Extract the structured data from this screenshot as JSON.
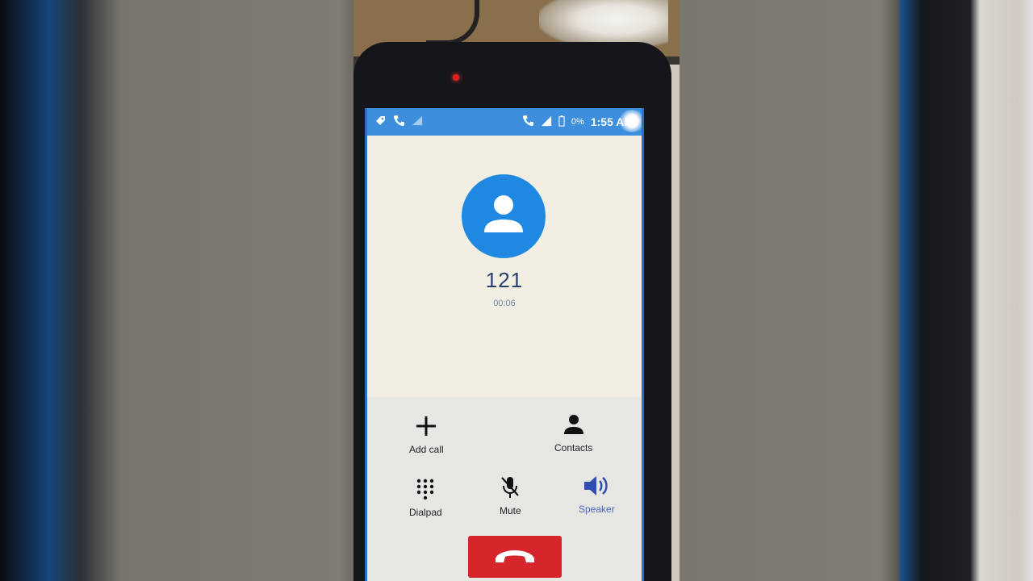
{
  "status_bar": {
    "time": "1:55 AM",
    "battery_percent": "0%",
    "left_icons": [
      "rocket-icon",
      "phone-icon",
      "signal-icon"
    ],
    "right_icons": [
      "call-forward-icon",
      "signal-strength-icon",
      "battery-icon"
    ]
  },
  "call": {
    "number": "121",
    "duration": "00:06"
  },
  "controls": {
    "add_call": {
      "label": "Add call",
      "icon": "plus-icon"
    },
    "contacts": {
      "label": "Contacts",
      "icon": "person-icon"
    },
    "dialpad": {
      "label": "Dialpad",
      "icon": "dialpad-icon"
    },
    "mute": {
      "label": "Mute",
      "icon": "mic-off-icon"
    },
    "speaker": {
      "label": "Speaker",
      "icon": "speaker-icon",
      "active": true
    },
    "end_call": {
      "icon": "hang-up-icon"
    }
  },
  "colors": {
    "status_bar": "#3d8fde",
    "avatar": "#1f88e0",
    "end_call": "#d7262b",
    "active_control": "#4a63b8"
  }
}
